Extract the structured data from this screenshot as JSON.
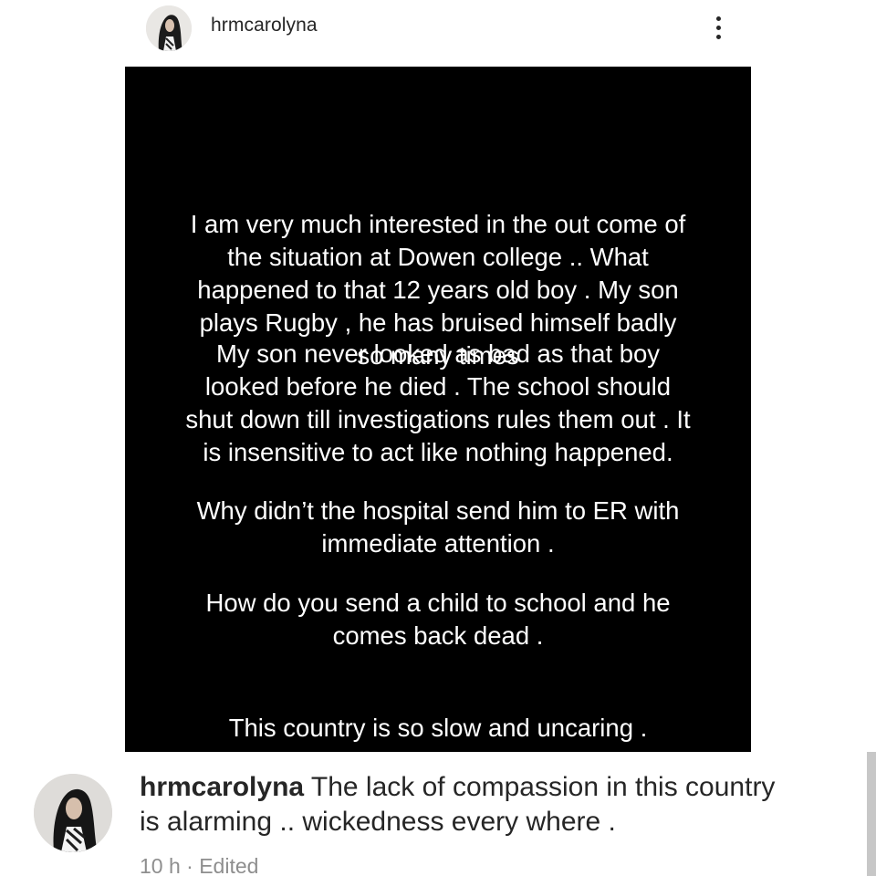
{
  "header": {
    "username": "hrmcarolyna",
    "avatar_icon": "profile-avatar",
    "menu_icon": "more-vertical-icon"
  },
  "post": {
    "background": "#000000",
    "text_color": "#ffffff",
    "paragraphs": [
      "I am very much interested in the out come of\nthe situation at Dowen college .. What\nhappened to that 12 years old boy . My son\nplays Rugby , he has bruised himself badly\nso many times",
      "My son never looked as bad as that boy\nlooked before he died . The school should\nshut down till investigations rules them out . It\nis insensitive to act like nothing happened.",
      "Why didn’t the hospital send him to ER with\nimmediate attention .",
      "How do you send a child to school and he\ncomes back dead .",
      "This country is so slow and uncaring ."
    ]
  },
  "caption": {
    "author": "hrmcarolyna",
    "text": " The lack of compassion in this country is alarming .. wickedness every where .",
    "meta": "10 h · Edited"
  }
}
